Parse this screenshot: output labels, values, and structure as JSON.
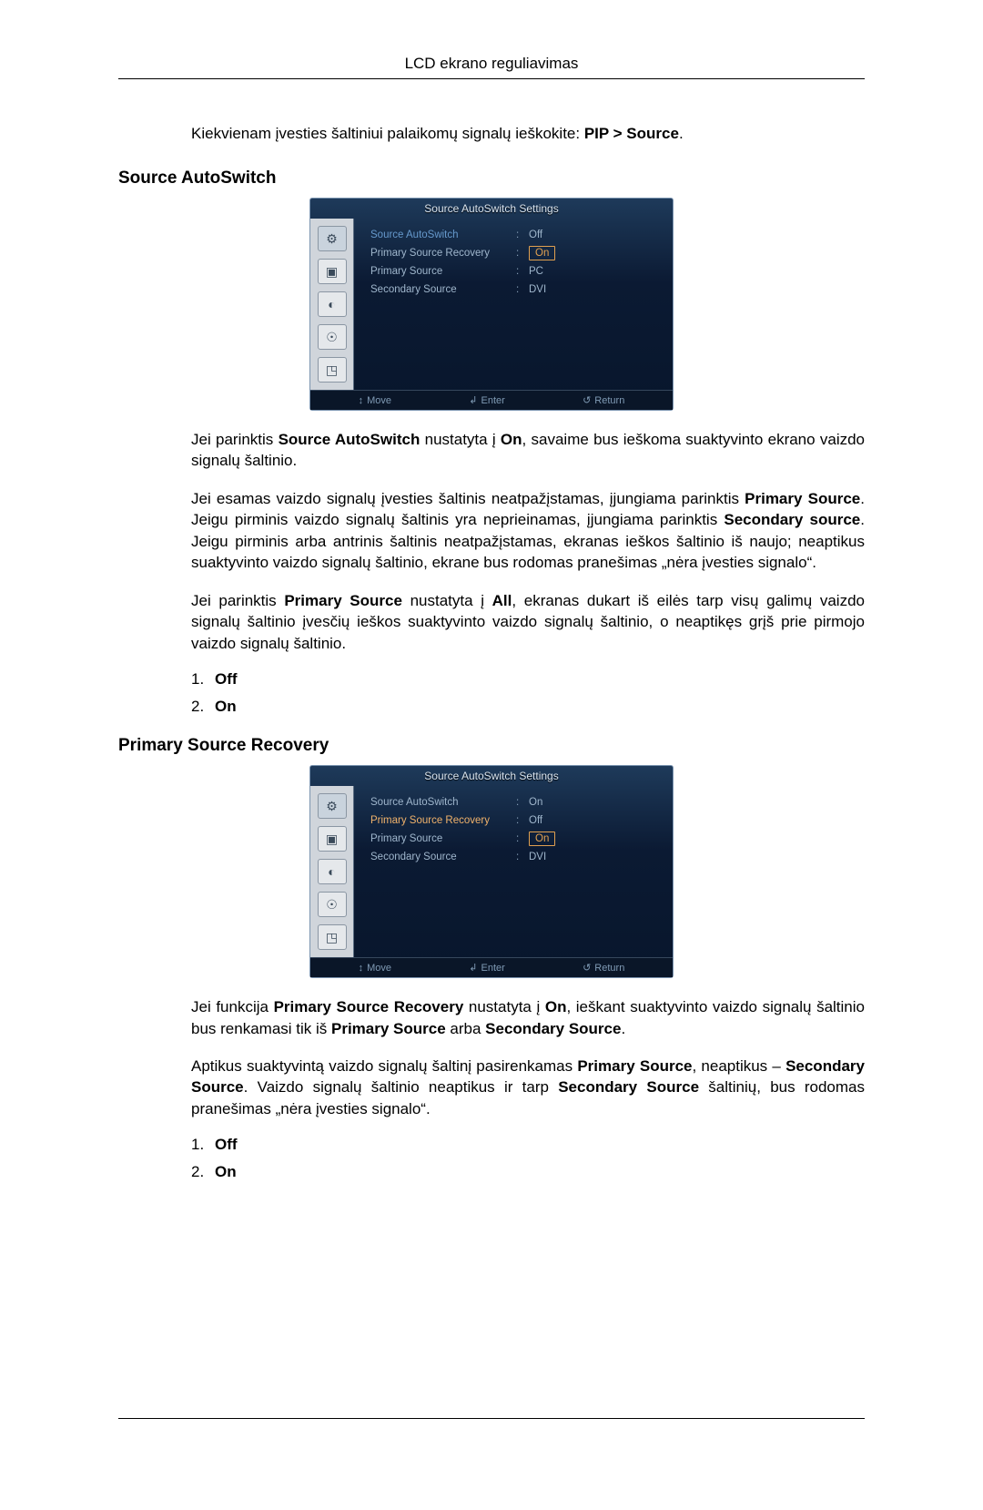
{
  "header": {
    "title": "LCD ekrano reguliavimas"
  },
  "intro": {
    "prefix": "Kiekvienam įvesties šaltiniui palaikomų signalų ieškokite: ",
    "path": "PIP > Source",
    "suffix": "."
  },
  "section1": {
    "heading": "Source AutoSwitch",
    "osd": {
      "title": "Source AutoSwitch Settings",
      "rows": [
        {
          "label": "Source AutoSwitch",
          "value": "Off",
          "label_style": "hl",
          "value_style": "dim"
        },
        {
          "label": "Primary Source Recovery",
          "value": "On",
          "label_style": "",
          "value_style": "boxed"
        },
        {
          "label": "Primary Source",
          "value": "PC",
          "label_style": "",
          "value_style": "pc"
        },
        {
          "label": "Secondary Source",
          "value": "DVI",
          "label_style": "",
          "value_style": "pc"
        }
      ],
      "footer": {
        "move": "Move",
        "enter": "Enter",
        "return": "Return"
      }
    },
    "para1": {
      "t1": "Jei parinktis ",
      "b1": "Source AutoSwitch",
      "t2": " nustatyta į ",
      "b2": "On",
      "t3": ", savaime bus ieškoma suaktyvinto ekrano vaizdo signalų šaltinio."
    },
    "para2": {
      "t1": "Jei esamas vaizdo signalų įvesties šaltinis neatpažįstamas, įjungiama parinktis ",
      "b1": "Primary Source",
      "t2": ". Jeigu pirminis vaizdo signalų šaltinis yra neprieinamas, įjungiama parinktis ",
      "b2": "Secondary source",
      "t3": ". Jeigu pirminis arba antrinis šaltinis neatpažįstamas, ekranas ieškos šaltinio iš naujo; neaptikus suaktyvinto vaizdo signalų šaltinio, ekrane bus rodomas pranešimas „nėra įvesties signalo“."
    },
    "para3": {
      "t1": "Jei parinktis ",
      "b1": "Primary Source",
      "t2": " nustatyta į ",
      "b2": "All",
      "t3": ", ekranas dukart iš eilės tarp visų galimų vaizdo signalų šaltinio įvesčių ieškos suaktyvinto vaizdo signalų šaltinio, o neaptikęs grįš prie pirmojo vaizdo signalų šaltinio."
    },
    "options": [
      {
        "num": "1.",
        "val": "Off"
      },
      {
        "num": "2.",
        "val": "On"
      }
    ]
  },
  "section2": {
    "heading": "Primary Source Recovery",
    "osd": {
      "title": "Source AutoSwitch Settings",
      "rows": [
        {
          "label": "Source AutoSwitch",
          "value": "On",
          "label_style": "",
          "value_style": "dim"
        },
        {
          "label": "Primary Source Recovery",
          "value": "Off",
          "label_style": "sel",
          "value_style": "dim"
        },
        {
          "label": "Primary Source",
          "value": "On",
          "label_style": "",
          "value_style": "boxed"
        },
        {
          "label": "Secondary Source",
          "value": "DVI",
          "label_style": "",
          "value_style": "pc"
        }
      ],
      "footer": {
        "move": "Move",
        "enter": "Enter",
        "return": "Return"
      }
    },
    "para1": {
      "t1": "Jei funkcija ",
      "b1": "Primary Source Recovery",
      "t2": " nustatyta į ",
      "b2": "On",
      "t3": ", ieškant suaktyvinto vaizdo signalų šaltinio bus renkamasi tik iš ",
      "b3": "Primary Source",
      "t4": " arba ",
      "b4": "Secondary Source",
      "t5": "."
    },
    "para2": {
      "t1": "Aptikus suaktyvintą vaizdo signalų šaltinį pasirenkamas ",
      "b1": "Primary Source",
      "t2": ", neaptikus – ",
      "b2": "Secondary Source",
      "t3": ". Vaizdo signalų šaltinio neaptikus ir tarp ",
      "b3": "Secondary Source",
      "t4": " šaltinių, bus rodomas pranešimas „nėra įvesties signalo“."
    },
    "options": [
      {
        "num": "1.",
        "val": "Off"
      },
      {
        "num": "2.",
        "val": "On"
      }
    ]
  },
  "icons": {
    "move": "↕",
    "enter": "↲",
    "return": "↺",
    "side1": "⚙",
    "side2": "▣",
    "side3": "◐",
    "side4": "☉",
    "side5": "◳"
  }
}
